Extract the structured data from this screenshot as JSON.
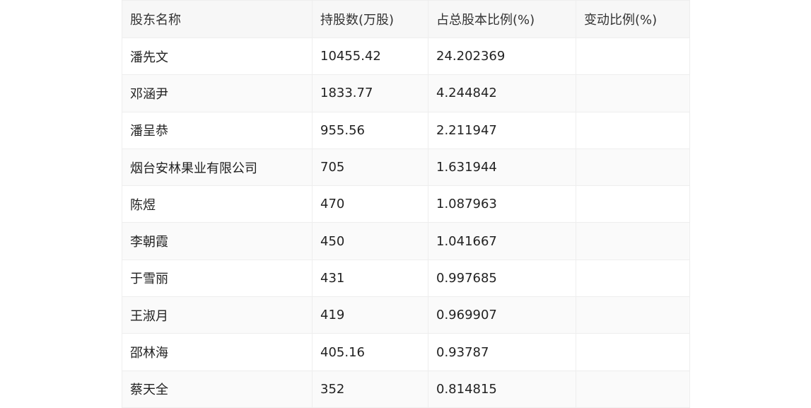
{
  "table": {
    "headers": [
      "股东名称",
      "持股数(万股)",
      "占总股本比例(%)",
      "变动比例(%)"
    ],
    "rows": [
      [
        "潘先文",
        "10455.42",
        "24.202369",
        ""
      ],
      [
        "邓涵尹",
        "1833.77",
        "4.244842",
        ""
      ],
      [
        "潘呈恭",
        "955.56",
        "2.211947",
        ""
      ],
      [
        "烟台安林果业有限公司",
        "705",
        "1.631944",
        ""
      ],
      [
        "陈煜",
        "470",
        "1.087963",
        ""
      ],
      [
        "李朝霞",
        "450",
        "1.041667",
        ""
      ],
      [
        "于雪丽",
        "431",
        "0.997685",
        ""
      ],
      [
        "王淑月",
        "419",
        "0.969907",
        ""
      ],
      [
        "邵林海",
        "405.16",
        "0.93787",
        ""
      ],
      [
        "蔡天全",
        "352",
        "0.814815",
        ""
      ]
    ]
  }
}
